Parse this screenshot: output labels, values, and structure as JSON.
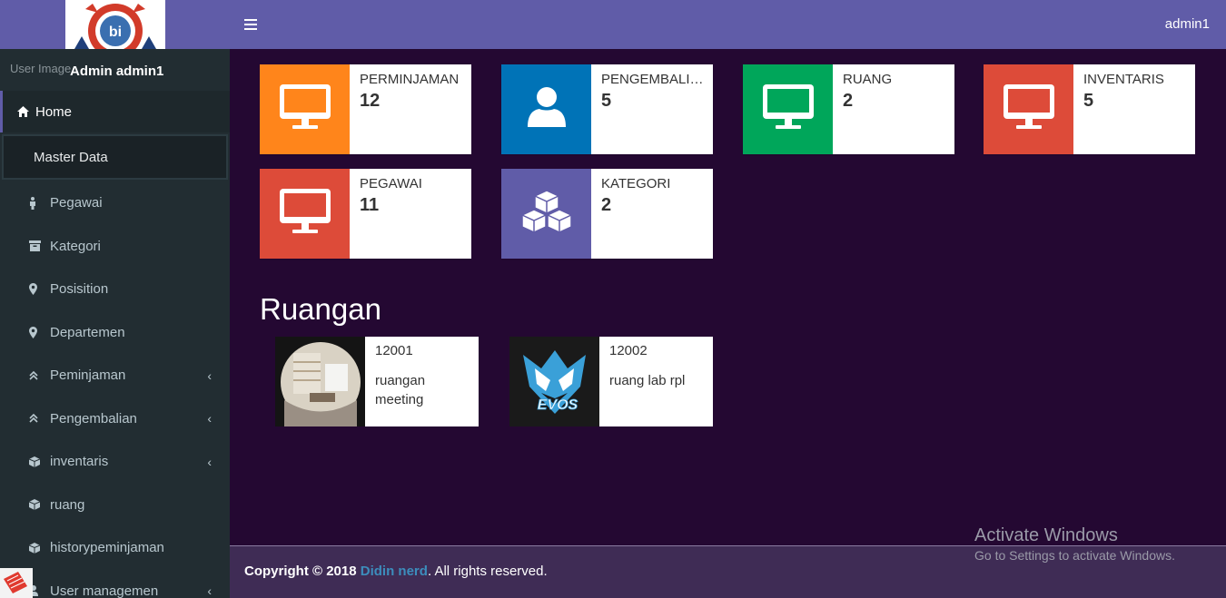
{
  "colors": {
    "sidebar": "#222d32",
    "topbar": "#605ca8",
    "content": "#240832",
    "orange": "#ff851b",
    "blue": "#0073b7",
    "green": "#00a65a",
    "red": "#dd4b39",
    "purple": "#605ca8"
  },
  "sidebar": {
    "user_img_alt": "User Image",
    "user_name": "Admin admin1",
    "home_label": "Home",
    "header_label": "Master Data",
    "items": [
      {
        "label": "Pegawai",
        "icon": "male-icon"
      },
      {
        "label": "Kategori",
        "icon": "archive-icon"
      },
      {
        "label": "Posisition",
        "icon": "map-marker-icon"
      },
      {
        "label": "Departemen",
        "icon": "map-marker-icon"
      },
      {
        "label": "Peminjaman",
        "icon": "angle-double-up-icon"
      },
      {
        "label": "Pengembalian",
        "icon": "angle-double-up-icon"
      },
      {
        "label": "inventaris",
        "icon": "cube-icon"
      },
      {
        "label": "ruang",
        "icon": "cube-icon"
      },
      {
        "label": "historypeminjaman",
        "icon": "cube-icon"
      },
      {
        "label": "User managemen",
        "icon": "user-icon"
      }
    ]
  },
  "topbar": {
    "user_label": "admin1"
  },
  "stats": [
    {
      "label": "PERMINJAMAN",
      "value": "12",
      "color": "#ff851b",
      "icon": "desktop-icon"
    },
    {
      "label": "PENGEMBALIAN",
      "value": "5",
      "color": "#0073b7",
      "icon": "user-icon"
    },
    {
      "label": "RUANG",
      "value": "2",
      "color": "#00a65a",
      "icon": "desktop-icon"
    },
    {
      "label": "INVENTARIS",
      "value": "5",
      "color": "#dd4b39",
      "icon": "desktop-icon"
    },
    {
      "label": "PEGAWAI",
      "value": "11",
      "color": "#dd4b39",
      "icon": "desktop-icon"
    },
    {
      "label": "KATEGORI",
      "value": "2",
      "color": "#605ca8",
      "icon": "cubes-icon"
    }
  ],
  "rooms_section": {
    "title": "Ruangan",
    "rooms": [
      {
        "code": "12001",
        "name": "ruangan meeting"
      },
      {
        "code": "12002",
        "name": "ruang lab rpl",
        "logo_text": "EVOS"
      }
    ]
  },
  "footer": {
    "prefix": "Copyright © 2018",
    "author": "Didin nerd",
    "suffix": ". All rights reserved."
  },
  "watermark": {
    "line1": "Activate Windows",
    "line2": "Go to Settings to activate Windows."
  }
}
